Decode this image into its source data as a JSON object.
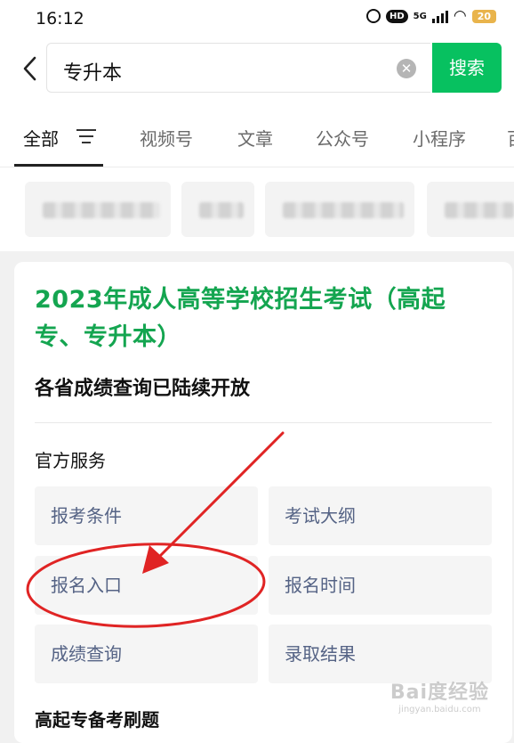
{
  "status_bar": {
    "time": "16:12",
    "network": "5G",
    "hd_badge": "HD",
    "battery": "20"
  },
  "search": {
    "query": "专升本",
    "button_label": "搜索",
    "accent_color": "#07c160"
  },
  "tabs": [
    {
      "label": "全部",
      "active": true
    },
    {
      "label": "视频号"
    },
    {
      "label": "文章"
    },
    {
      "label": "公众号"
    },
    {
      "label": "小程序"
    },
    {
      "label": "百"
    }
  ],
  "card": {
    "title": "2023年成人高等学校招生考试（高起专、专升本）",
    "subtitle": "各省成绩查询已陆续开放",
    "section_title": "官方服务",
    "services": [
      {
        "label": "报考条件"
      },
      {
        "label": "考试大纲"
      },
      {
        "label": "报名入口"
      },
      {
        "label": "报名时间"
      },
      {
        "label": "成绩查询"
      },
      {
        "label": "录取结果"
      }
    ],
    "next_section_title": "高起专备考刷题"
  },
  "annotation": {
    "color": "#e02424"
  },
  "watermark": {
    "logo": "Bai度经验",
    "url": "jingyan.baidu.com"
  }
}
